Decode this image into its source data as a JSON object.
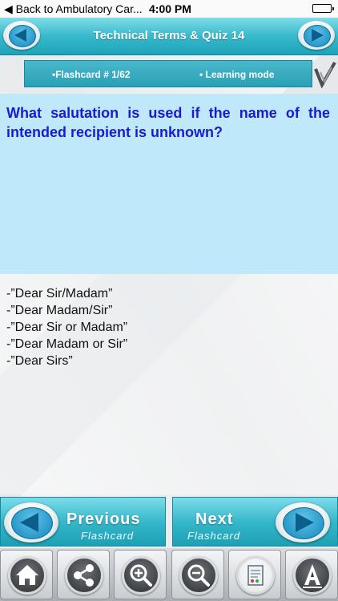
{
  "status_bar": {
    "back_label": "Back to Ambulatory Car...",
    "time": "4:00 PM"
  },
  "header": {
    "title": "Technical Terms & Quiz   14"
  },
  "info_bar": {
    "flashcard_label": "•Flashcard #  1/62",
    "mode_label": "• Learning mode"
  },
  "question": {
    "text": "What salutation is used if the name of the intended recipient is unknown?"
  },
  "answers": [
    "-”Dear Sir/Madam”",
    "-”Dear Madam/Sir”",
    "-”Dear Sir or Madam”",
    "-”Dear Madam or Sir”",
    "-”Dear Sirs”"
  ],
  "previous_button": {
    "label": "Previous",
    "sublabel": "Flashcard"
  },
  "next_button": {
    "label": "Next",
    "sublabel": "Flashcard"
  },
  "toolbar": {
    "icons": [
      "home-icon",
      "share-icon",
      "zoom-in-icon",
      "zoom-out-icon",
      "notes-icon",
      "font-icon"
    ]
  },
  "colors": {
    "accent": "#2aa0b6",
    "question_bg": "#bfe8fb",
    "question_text": "#1a1ad6"
  }
}
